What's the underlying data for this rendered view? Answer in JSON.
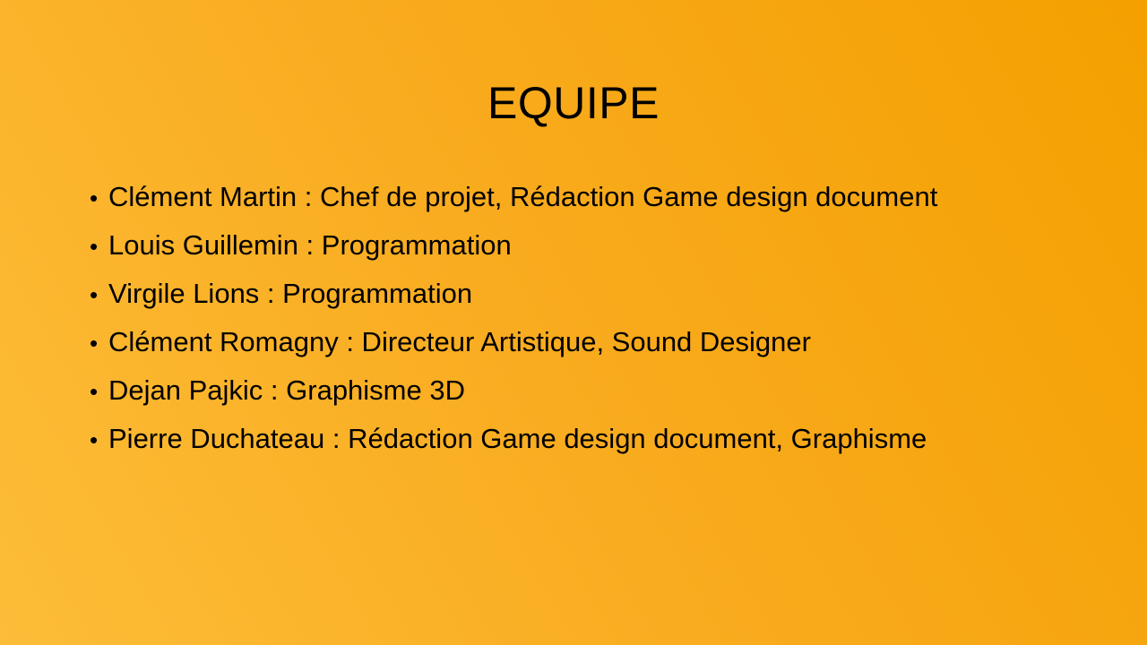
{
  "slide": {
    "title": "EQUIPE",
    "bullet_glyph": "•",
    "items": [
      "Clément Martin : Chef de projet, Rédaction Game design document",
      "Louis Guillemin : Programmation",
      "Virgile Lions : Programmation",
      "Clément Romagny : Directeur Artistique, Sound Designer",
      "Dejan Pajkic : Graphisme 3D",
      "Pierre Duchateau : Rédaction Game design document, Graphisme"
    ]
  },
  "colors": {
    "background_start": "#fdbd38",
    "background_end": "#f4a000",
    "text": "#000000"
  }
}
